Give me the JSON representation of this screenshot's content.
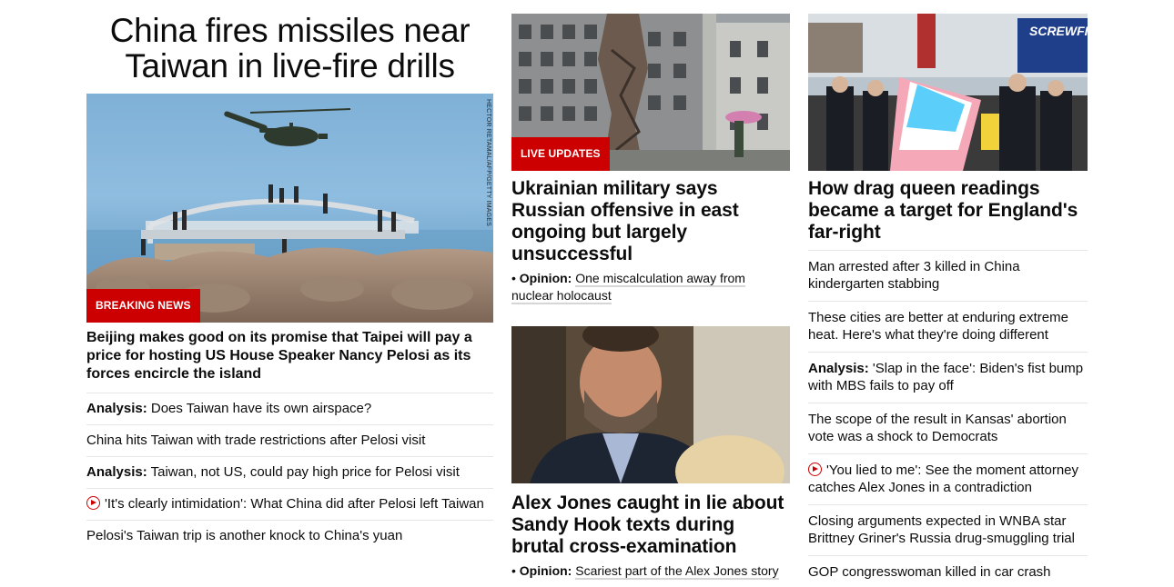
{
  "left": {
    "headline": "China fires missiles near Taiwan in live-fire drills",
    "image_credit": "HECTOR RETAMAL/AFP/GETTY IMAGES",
    "badge": "BREAKING NEWS",
    "lead_text": "Beijing makes good on its promise that Taipei will pay a price for hosting US House Speaker Nancy Pelosi as its forces encircle the island",
    "links": [
      {
        "label": "Analysis:",
        "text": " Does Taiwan have its own airspace?"
      },
      {
        "label": "",
        "text": "China hits Taiwan with trade restrictions after Pelosi visit"
      },
      {
        "label": "Analysis:",
        "text": " Taiwan, not US, could pay high price for Pelosi visit"
      },
      {
        "label": "",
        "text": "'It's clearly intimidation': What China did after Pelosi left Taiwan",
        "video": true
      },
      {
        "label": "",
        "text": "Pelosi's Taiwan trip is another knock to China's yuan"
      }
    ]
  },
  "middle": {
    "card1": {
      "badge": "LIVE UPDATES",
      "headline": "Ukrainian military says Russian offensive in east ongoing but largely unsuccessful",
      "bullet": "•",
      "opinion_label": "Opinion:",
      "opinion_text": "One miscalculation away from nuclear holocaust"
    },
    "card2": {
      "headline": "Alex Jones caught in lie about Sandy Hook texts during brutal cross-examination",
      "bullet": "•",
      "opinion_label": "Opinion:",
      "opinion_text": "Scariest part of the Alex Jones story"
    }
  },
  "right": {
    "headline": "How drag queen readings became a target for England's far-right",
    "store_sign": "SCREWFIX",
    "links": [
      {
        "label": "",
        "text": "Man arrested after 3 killed in China kindergarten stabbing"
      },
      {
        "label": "",
        "text": "These cities are better at enduring extreme heat. Here's what they're doing different"
      },
      {
        "label": "Analysis:",
        "text": " 'Slap in the face': Biden's fist bump with MBS fails to pay off"
      },
      {
        "label": "",
        "text": "The scope of the result in Kansas' abortion vote was a shock to Democrats"
      },
      {
        "label": "",
        "text": "'You lied to me': See the moment attorney catches Alex Jones in a contradiction",
        "video": true
      },
      {
        "label": "",
        "text": "Closing arguments expected in WNBA star Brittney Griner's Russia drug-smuggling trial"
      },
      {
        "label": "",
        "text": "GOP congresswoman killed in car crash"
      }
    ]
  },
  "colors": {
    "red": "#cc0000",
    "divider": "#e6e6e6",
    "text": "#0c0c0c"
  }
}
